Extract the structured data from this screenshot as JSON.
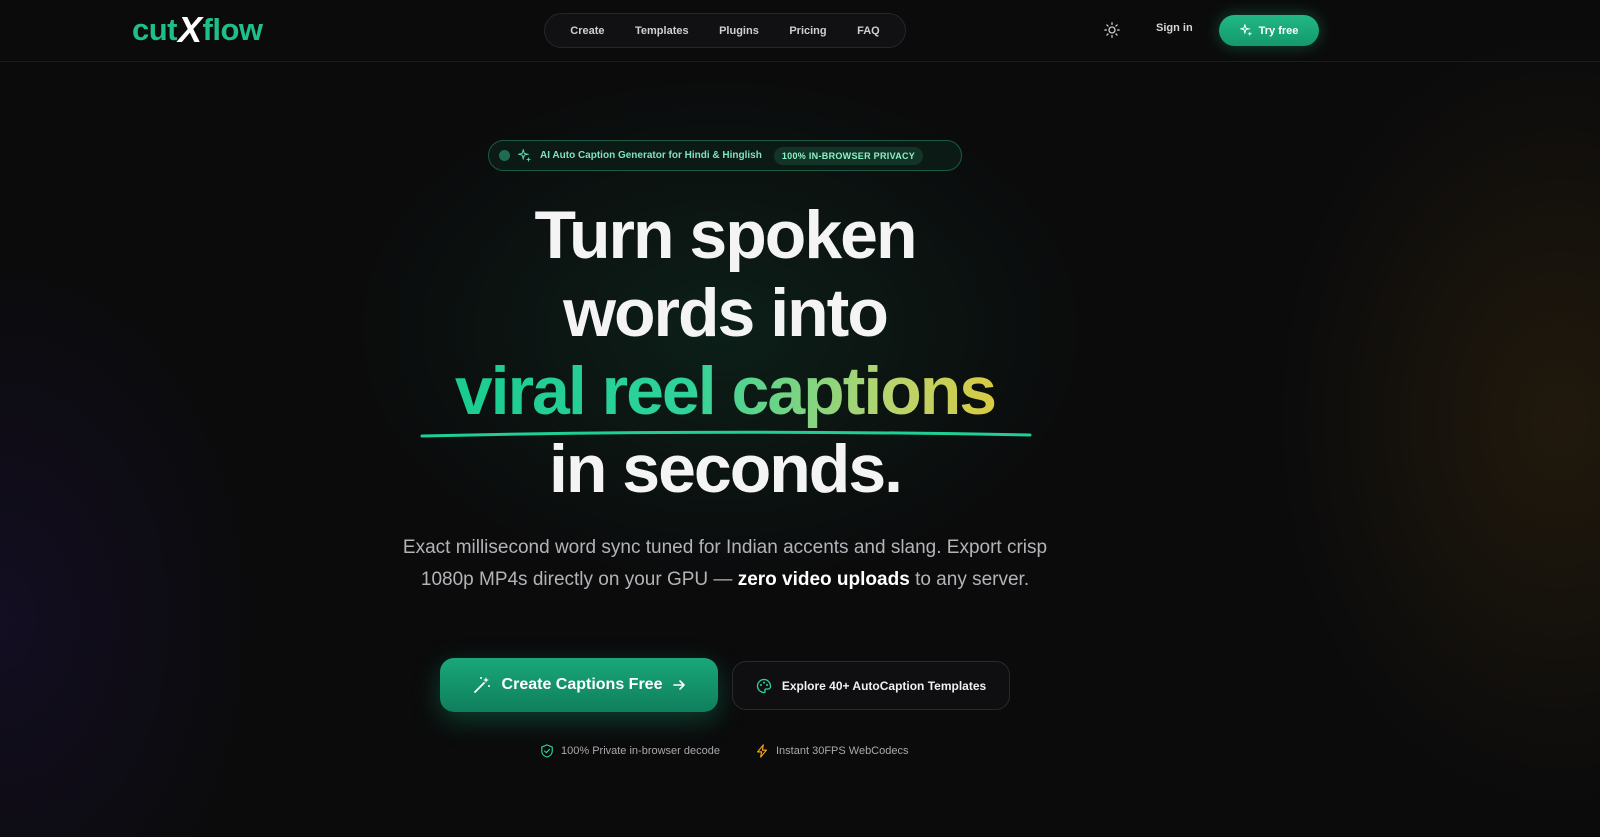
{
  "nav": {
    "logo_left": "cut",
    "logo_x": "X",
    "logo_right": "flow",
    "links": [
      "Create",
      "Templates",
      "Plugins",
      "Pricing",
      "FAQ"
    ],
    "sign_in": "Sign in",
    "try_free": "Try free"
  },
  "badge": {
    "text": "AI Auto Caption Generator for Hindi & Hinglish",
    "tag": "100% IN-BROWSER PRIVACY"
  },
  "hero": {
    "line1": "Turn spoken",
    "line2": "words into",
    "line3": "viral reel captions",
    "line4": "in seconds.",
    "sub_part1": "Exact millisecond word sync tuned for Indian accents and slang. Export crisp 1080p MP4s directly on your GPU —",
    "sub_bold": "zero video uploads",
    "sub_part2": "to any server."
  },
  "cta": {
    "primary": "Create Captions Free",
    "secondary": "Explore 40+ AutoCaption Templates"
  },
  "features": [
    {
      "label": "100% Private in-browser decode",
      "icon": "shield-check-icon"
    },
    {
      "label": "Instant 30FPS WebCodecs",
      "icon": "lightning-icon"
    }
  ],
  "colors": {
    "accent": "#1fbf8a",
    "gradient_end": "#f6c21c",
    "background": "#0b0b0c"
  }
}
